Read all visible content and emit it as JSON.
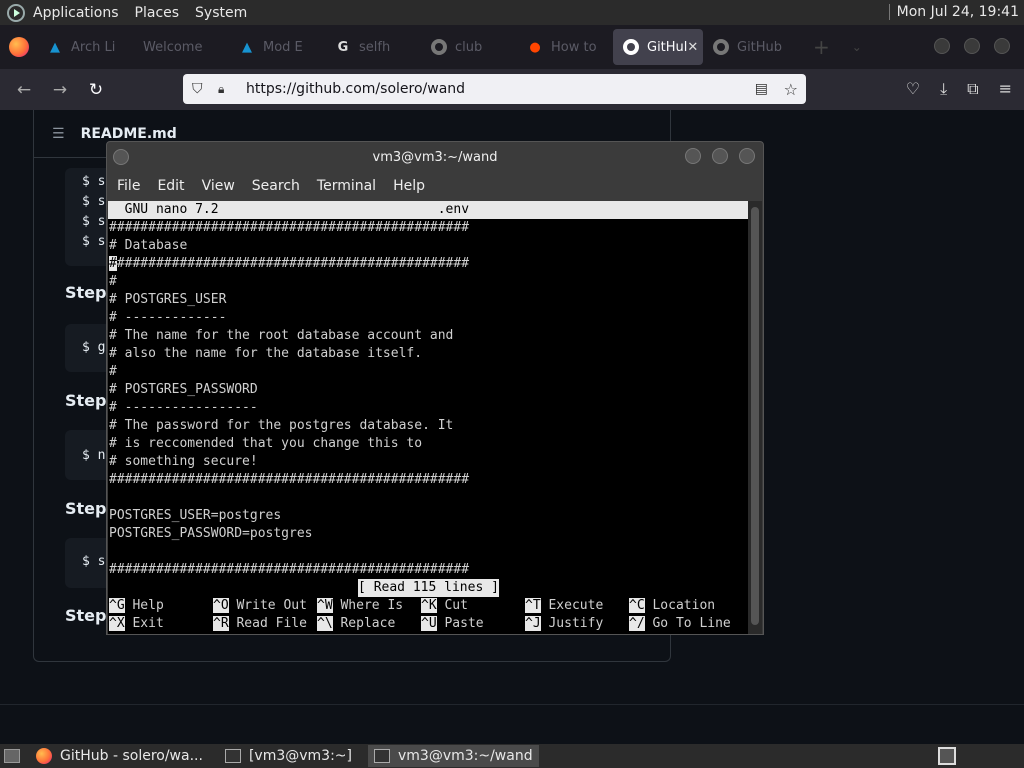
{
  "system_panel": {
    "menus": [
      "Applications",
      "Places",
      "System"
    ],
    "clock": "Mon Jul 24, 19:41"
  },
  "browser": {
    "tabs": [
      {
        "label": "Arch Li",
        "icon": "arch-icon"
      },
      {
        "label": "Welcome",
        "icon": "none"
      },
      {
        "label": "Mod E",
        "icon": "arch-icon"
      },
      {
        "label": "selfh",
        "icon": "google-icon"
      },
      {
        "label": "club",
        "icon": "github-icon"
      },
      {
        "label": "How to",
        "icon": "reddit-icon"
      },
      {
        "label": "GitHul",
        "icon": "github-icon",
        "active": true
      },
      {
        "label": "GitHub",
        "icon": "github-icon"
      }
    ],
    "close_glyph": "✕",
    "new_tab_glyph": "+",
    "url": "https://github.com/solero/wand"
  },
  "github": {
    "readme_title": "README.md",
    "steps_label": "Step",
    "code_blocks": [
      {
        "lines": [
          "$ s",
          "$ s",
          "$ s",
          "$ s"
        ]
      },
      {
        "lines": [
          "$ g"
        ]
      },
      {
        "lines": [
          "$ n"
        ]
      },
      {
        "lines": [
          "$ s"
        ]
      }
    ]
  },
  "terminal": {
    "title": "vm3@vm3:~/wand",
    "menu": [
      "File",
      "Edit",
      "View",
      "Search",
      "Terminal",
      "Help"
    ],
    "nano_header": "  GNU nano 7.2                            .env                                  ",
    "lines": [
      "##############################################",
      "# Database",
      "##############################################",
      "#",
      "# POSTGRES_USER",
      "# -------------",
      "# The name for the root database account and",
      "# also the name for the database itself.",
      "#",
      "# POSTGRES_PASSWORD",
      "# -----------------",
      "# The password for the postgres database. It",
      "# is reccomended that you change this to",
      "# something secure!",
      "##############################################",
      "",
      "POSTGRES_USER=postgres",
      "POSTGRES_PASSWORD=postgres",
      "",
      "##############################################"
    ],
    "status": "[ Read 115 lines ]",
    "shortcuts_row1": [
      {
        "key": "^G",
        "label": "Help"
      },
      {
        "key": "^O",
        "label": "Write Out"
      },
      {
        "key": "^W",
        "label": "Where Is"
      },
      {
        "key": "^K",
        "label": "Cut"
      },
      {
        "key": "^T",
        "label": "Execute"
      },
      {
        "key": "^C",
        "label": "Location"
      }
    ],
    "shortcuts_row2": [
      {
        "key": "^X",
        "label": "Exit"
      },
      {
        "key": "^R",
        "label": "Read File"
      },
      {
        "key": "^\\",
        "label": "Replace"
      },
      {
        "key": "^U",
        "label": "Paste"
      },
      {
        "key": "^J",
        "label": "Justify"
      },
      {
        "key": "^/",
        "label": "Go To Line"
      }
    ]
  },
  "taskbar": {
    "items": [
      {
        "label": "GitHub - solero/wa...",
        "icon": "firefox-icon"
      },
      {
        "label": "[vm3@vm3:~]",
        "icon": "terminal-icon"
      },
      {
        "label": "vm3@vm3:~/wand",
        "icon": "terminal-icon",
        "active": true
      }
    ]
  }
}
